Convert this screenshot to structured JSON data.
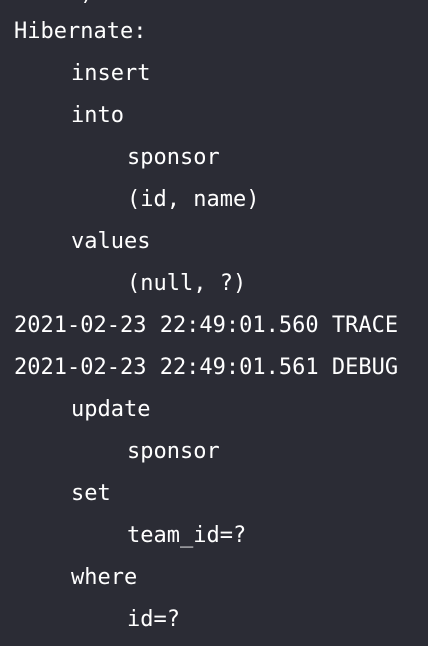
{
  "console": {
    "partial_top_text": "     )",
    "lines": [
      {
        "indent": 0,
        "text": "Hibernate:"
      },
      {
        "indent": 1,
        "text": "insert"
      },
      {
        "indent": 1,
        "text": "into"
      },
      {
        "indent": 2,
        "text": "sponsor"
      },
      {
        "indent": 2,
        "text": "(id, name)"
      },
      {
        "indent": 1,
        "text": "values"
      },
      {
        "indent": 2,
        "text": "(null, ?)"
      },
      {
        "indent": 0,
        "text": "2021-02-23 22:49:01.560 TRACE"
      },
      {
        "indent": 0,
        "text": "2021-02-23 22:49:01.561 DEBUG"
      },
      {
        "indent": 1,
        "text": "update"
      },
      {
        "indent": 2,
        "text": "sponsor"
      },
      {
        "indent": 1,
        "text": "set"
      },
      {
        "indent": 2,
        "text": "team_id=?"
      },
      {
        "indent": 1,
        "text": "where"
      },
      {
        "indent": 2,
        "text": "id=?"
      }
    ]
  },
  "colors": {
    "background": "#2b2c35",
    "text": "#ffffff"
  }
}
